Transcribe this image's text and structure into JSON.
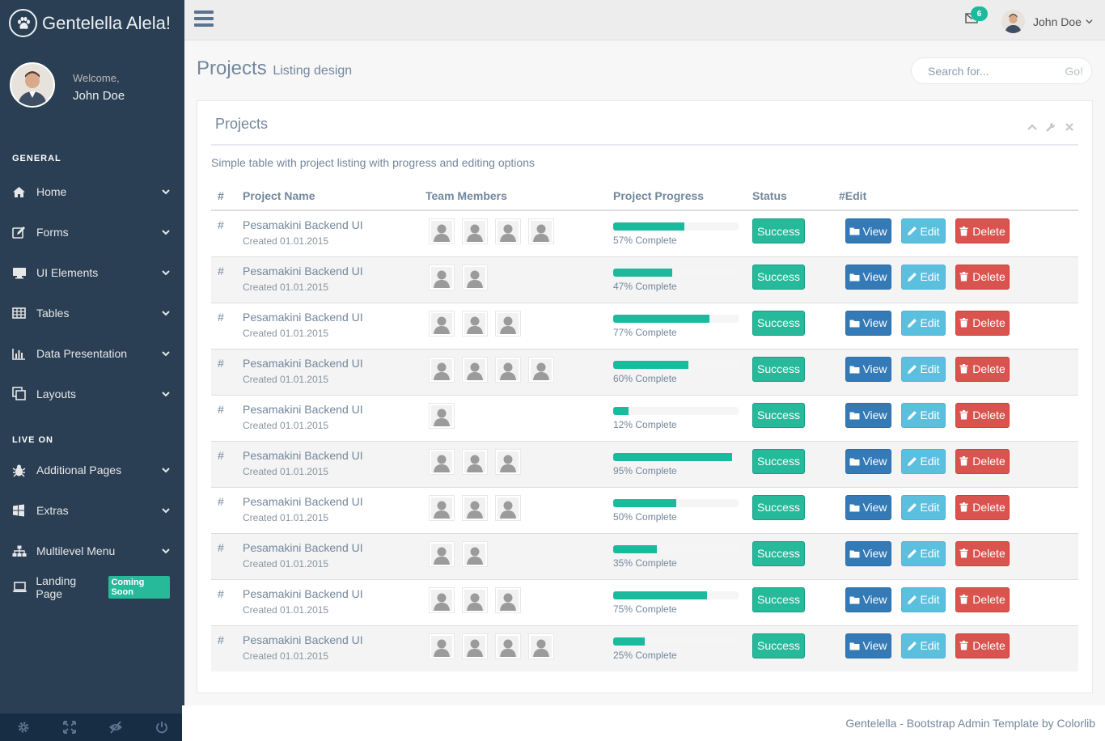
{
  "brand": {
    "title": "Gentelella Alela!"
  },
  "profile": {
    "welcome": "Welcome,",
    "name": "John Doe"
  },
  "sidebar": {
    "sections": [
      {
        "title": "GENERAL",
        "items": [
          {
            "label": "Home",
            "icon": "home-icon"
          },
          {
            "label": "Forms",
            "icon": "edit-icon"
          },
          {
            "label": "UI Elements",
            "icon": "desktop-icon"
          },
          {
            "label": "Tables",
            "icon": "table-icon"
          },
          {
            "label": "Data Presentation",
            "icon": "bar-chart-icon"
          },
          {
            "label": "Layouts",
            "icon": "clone-icon"
          }
        ]
      },
      {
        "title": "LIVE ON",
        "items": [
          {
            "label": "Additional Pages",
            "icon": "bug-icon"
          },
          {
            "label": "Extras",
            "icon": "windows-icon"
          },
          {
            "label": "Multilevel Menu",
            "icon": "sitemap-icon"
          },
          {
            "label": "Landing Page",
            "icon": "laptop-icon",
            "badge": "Coming Soon"
          }
        ]
      }
    ]
  },
  "topnav": {
    "mail_count": "6",
    "user_name": "John Doe"
  },
  "page": {
    "title": "Projects",
    "subtitle": "Listing design"
  },
  "search": {
    "placeholder": "Search for...",
    "button": "Go!"
  },
  "panel": {
    "title": "Projects",
    "description": "Simple table with project listing with progress and editing options",
    "columns": [
      "#",
      "Project Name",
      "Team Members",
      "Project Progress",
      "Status",
      "#Edit"
    ],
    "buttons": {
      "view": "View",
      "edit": "Edit",
      "delete": "Delete"
    },
    "rows": [
      {
        "hash": "#",
        "name": "Pesamakini Backend UI",
        "created": "Created 01.01.2015",
        "members": 4,
        "progress": 57,
        "progress_text": "57% Complete",
        "status": "Success"
      },
      {
        "hash": "#",
        "name": "Pesamakini Backend UI",
        "created": "Created 01.01.2015",
        "members": 2,
        "progress": 47,
        "progress_text": "47% Complete",
        "status": "Success"
      },
      {
        "hash": "#",
        "name": "Pesamakini Backend UI",
        "created": "Created 01.01.2015",
        "members": 3,
        "progress": 77,
        "progress_text": "77% Complete",
        "status": "Success"
      },
      {
        "hash": "#",
        "name": "Pesamakini Backend UI",
        "created": "Created 01.01.2015",
        "members": 4,
        "progress": 60,
        "progress_text": "60% Complete",
        "status": "Success"
      },
      {
        "hash": "#",
        "name": "Pesamakini Backend UI",
        "created": "Created 01.01.2015",
        "members": 1,
        "progress": 12,
        "progress_text": "12% Complete",
        "status": "Success"
      },
      {
        "hash": "#",
        "name": "Pesamakini Backend UI",
        "created": "Created 01.01.2015",
        "members": 3,
        "progress": 95,
        "progress_text": "95% Complete",
        "status": "Success"
      },
      {
        "hash": "#",
        "name": "Pesamakini Backend UI",
        "created": "Created 01.01.2015",
        "members": 3,
        "progress": 50,
        "progress_text": "50% Complete",
        "status": "Success"
      },
      {
        "hash": "#",
        "name": "Pesamakini Backend UI",
        "created": "Created 01.01.2015",
        "members": 2,
        "progress": 35,
        "progress_text": "35% Complete",
        "status": "Success"
      },
      {
        "hash": "#",
        "name": "Pesamakini Backend UI",
        "created": "Created 01.01.2015",
        "members": 3,
        "progress": 75,
        "progress_text": "75% Complete",
        "status": "Success"
      },
      {
        "hash": "#",
        "name": "Pesamakini Backend UI",
        "created": "Created 01.01.2015",
        "members": 4,
        "progress": 25,
        "progress_text": "25% Complete",
        "status": "Success"
      }
    ]
  },
  "footer": {
    "text": "Gentelella - Bootstrap Admin Template by Colorlib"
  },
  "colors": {
    "sidebar": "#2A3F54",
    "accent": "#1ABB9C",
    "success": "#26B99A",
    "view": "#337AB7",
    "edit": "#5BC0DE",
    "delete": "#D9534F"
  }
}
